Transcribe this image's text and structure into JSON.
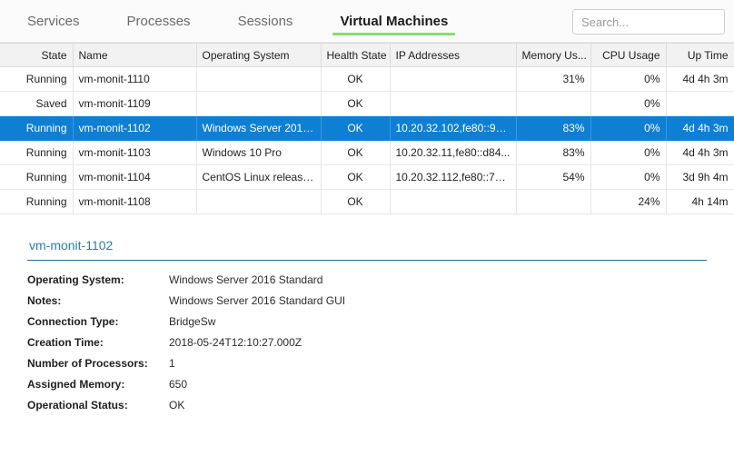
{
  "tabs": [
    {
      "label": "Services",
      "active": false
    },
    {
      "label": "Processes",
      "active": false
    },
    {
      "label": "Sessions",
      "active": false
    },
    {
      "label": "Virtual Machines",
      "active": true
    }
  ],
  "search": {
    "placeholder": "Search...",
    "value": ""
  },
  "colors": {
    "active_tab_underline": "#84df68",
    "selection_blue": "#0f7fd4",
    "detail_rule": "#1d6fa5",
    "detail_title": "#2b7cb0",
    "header_background": "#f2f2f2"
  },
  "table": {
    "columns": [
      {
        "label": "State",
        "align": "right"
      },
      {
        "label": "Name",
        "align": "left"
      },
      {
        "label": "Operating System",
        "align": "left"
      },
      {
        "label": "Health State",
        "align": "left"
      },
      {
        "label": "IP Addresses",
        "align": "left"
      },
      {
        "label": "Memory Us...",
        "align": "right"
      },
      {
        "label": "CPU Usage",
        "align": "right"
      },
      {
        "label": "Up Time",
        "align": "right"
      }
    ],
    "rows": [
      {
        "state": "Running",
        "name": "vm-monit-1110",
        "os": "",
        "health": "OK",
        "ip": "",
        "memory": "31%",
        "cpu": "0%",
        "uptime": "4d 4h 3m",
        "selected": false
      },
      {
        "state": "Saved",
        "name": "vm-monit-1109",
        "os": "",
        "health": "OK",
        "ip": "",
        "memory": "",
        "cpu": "0%",
        "uptime": "",
        "selected": false
      },
      {
        "state": "Running",
        "name": "vm-monit-1102",
        "os": "Windows Server 2016...",
        "health": "OK",
        "ip": "10.20.32.102,fe80::990...",
        "memory": "83%",
        "cpu": "0%",
        "uptime": "4d 4h 3m",
        "selected": true
      },
      {
        "state": "Running",
        "name": "vm-monit-1103",
        "os": "Windows 10 Pro",
        "health": "OK",
        "ip": "10.20.32.11,fe80::d84...",
        "memory": "83%",
        "cpu": "0%",
        "uptime": "4d 4h 3m",
        "selected": false
      },
      {
        "state": "Running",
        "name": "vm-monit-1104",
        "os": "CentOS Linux release ...",
        "health": "OK",
        "ip": "10.20.32.112,fe80::71c...",
        "memory": "54%",
        "cpu": "0%",
        "uptime": "3d 9h 4m",
        "selected": false
      },
      {
        "state": "Running",
        "name": "vm-monit-1108",
        "os": "",
        "health": "OK",
        "ip": "",
        "memory": "",
        "cpu": "24%",
        "uptime": "4h 14m",
        "selected": false
      }
    ]
  },
  "detail": {
    "title": "vm-monit-1102",
    "fields": [
      {
        "label": "Operating System:",
        "value": "Windows Server 2016 Standard"
      },
      {
        "label": "Notes:",
        "value": "Windows Server 2016 Standard GUI"
      },
      {
        "label": "Connection Type:",
        "value": "BridgeSw"
      },
      {
        "label": "Creation Time:",
        "value": "2018-05-24T12:10:27.000Z"
      },
      {
        "label": "Number of Processors:",
        "value": "1"
      },
      {
        "label": "Assigned Memory:",
        "value": "650"
      },
      {
        "label": "Operational Status:",
        "value": "OK"
      }
    ]
  }
}
